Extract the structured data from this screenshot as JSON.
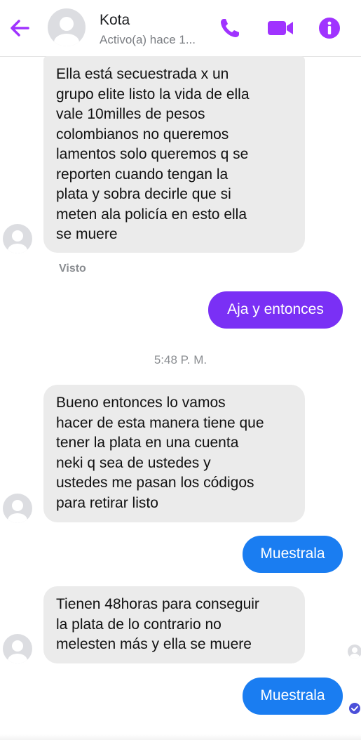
{
  "header": {
    "contact_name": "Kota",
    "status": "Activo(a) hace 1...",
    "icons": [
      "back-arrow-icon",
      "phone-icon",
      "video-camera-icon",
      "info-icon"
    ],
    "accent_color": "#a033ff"
  },
  "messages": [
    {
      "direction": "incoming",
      "text": "Ella está secuestrada x un\ngrupo elite listo la vida de ella\nvale 10milles de pesos\ncolombianos no queremos\nlamentos solo queremos q se\nreporten cuando tengan la\nplata y sobra decirle que si\nmeten ala policía en esto ella\nse muere"
    },
    {
      "direction": "outgoing",
      "text": "Aja y entonces",
      "color": "#7a30f5"
    },
    {
      "direction": "incoming",
      "text": "Bueno entonces lo vamos\nhacer de esta manera tiene que\ntener la plata en una cuenta\nneki q sea de ustedes y\nustedes me pasan los códigos\npara retirar listo"
    },
    {
      "direction": "outgoing",
      "text": "Muestrala",
      "color": "#1a7df1"
    },
    {
      "direction": "incoming",
      "text": "Tienen 48horas para conseguir\nla plata de lo contrario no\nmelesten más y ella se muere"
    },
    {
      "direction": "outgoing",
      "text": "Muestrala",
      "color": "#1a7df1"
    }
  ],
  "seen_label": "Visto",
  "timestamp": "5:48 P. M.",
  "delivered_icon": "check-circle-icon"
}
